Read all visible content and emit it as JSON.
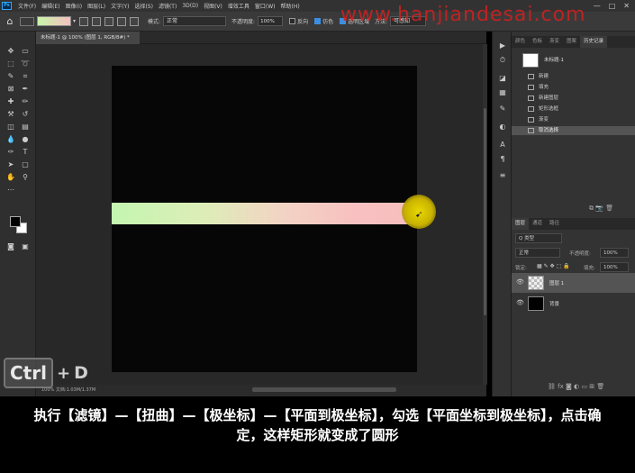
{
  "app": {
    "logo_text": "Ps"
  },
  "menu": [
    "文件(F)",
    "编辑(E)",
    "图像(I)",
    "图层(L)",
    "文字(Y)",
    "选择(S)",
    "滤镜(T)",
    "3D(D)",
    "视图(V)",
    "增效工具",
    "窗口(W)",
    "帮助(H)"
  ],
  "window_controls": [
    "—",
    "□",
    "✕"
  ],
  "watermark": "www.hanjiandesai.com",
  "options": {
    "mode_label": "模式:",
    "mode_value": "正常",
    "opacity_label": "不透明度:",
    "opacity_value": "100%",
    "reverse_label": "反向",
    "dither_label": "仿色",
    "transparency_label": "透明区域",
    "method_label": "方法:",
    "method_value": "可感知"
  },
  "document": {
    "tab_title": "未标题-1 @ 100% (图层 1, RGB/8#) *",
    "status": "100%    文档:1.03M/1.37M"
  },
  "shortcut": {
    "key1": "Ctrl",
    "plus": "+",
    "key2": "D"
  },
  "history_panel": {
    "tabs": [
      "颜色",
      "色板",
      "渐变",
      "图案",
      "历史记录"
    ],
    "active_tab": "历史记录",
    "snapshot": "未标题-1",
    "items": [
      "新建",
      "填充",
      "新建图层",
      "矩形选框",
      "渐变",
      "取消选择"
    ],
    "selected_index": 5
  },
  "layers_panel": {
    "tabs": [
      "图层",
      "通道",
      "路径"
    ],
    "filter": "Q 类型",
    "blend_mode": "正常",
    "opacity_label": "不透明度:",
    "opacity_value": "100%",
    "lock_label": "锁定:",
    "fill_label": "填充:",
    "fill_value": "100%",
    "layers": [
      {
        "name": "图层 1",
        "selected": true
      },
      {
        "name": "背景",
        "selected": false
      }
    ]
  },
  "subtitle": "执行【滤镜】—【扭曲】—【极坐标】—【平面到极坐标】，勾选【平面坐标到极坐标】，点击确定，这样矩形就变成了圆形",
  "colors": {
    "gradient_start": "#c4f6b0",
    "gradient_end": "#f6bebd",
    "cursor_highlight": "#e8d800",
    "watermark": "#d42020"
  }
}
